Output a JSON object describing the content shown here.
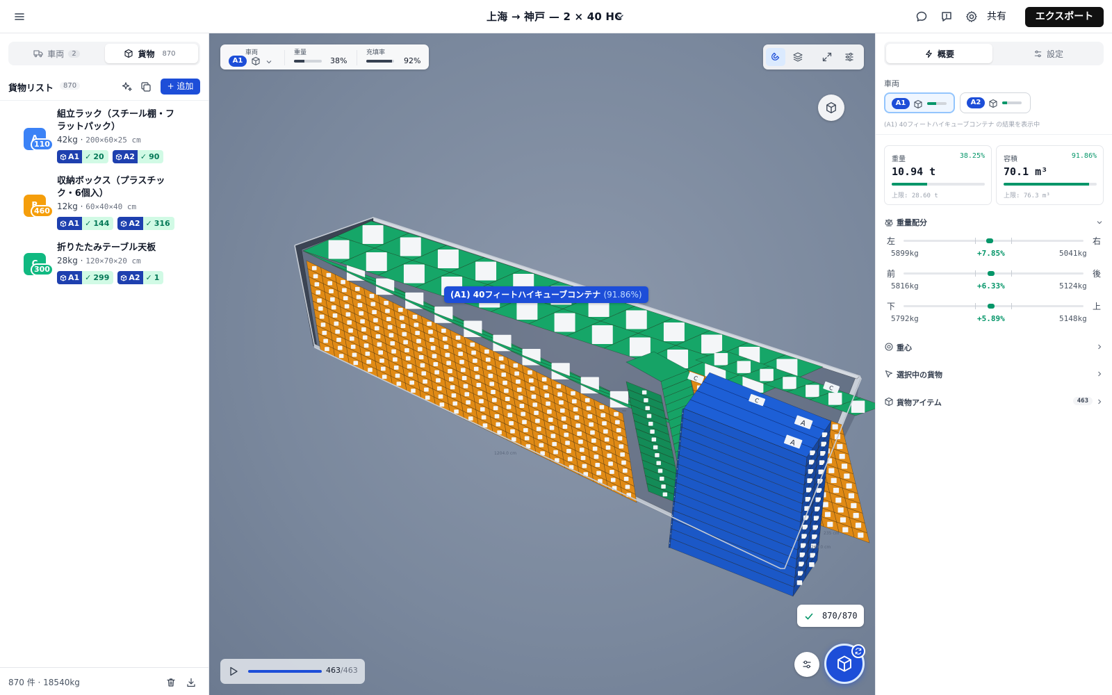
{
  "header": {
    "route_title": "上海 → 神戸 — 2 × 40 HC",
    "share_label": "共有",
    "export_label": "エクスポート"
  },
  "left": {
    "tabs": [
      {
        "label": "車両",
        "count": "2"
      },
      {
        "label": "貨物",
        "count": "870"
      }
    ],
    "list_title": "貨物リスト",
    "list_count": "870",
    "add_label": "+ 追加",
    "items": [
      {
        "badge": "A",
        "qty": "110",
        "color": "#3b82f6",
        "name": "組立ラック（スチール棚・フラットパック）",
        "weight": "42kg",
        "dims": "200×60×25 cm",
        "alloc": [
          {
            "vehicle": "A1",
            "count": "20"
          },
          {
            "vehicle": "A2",
            "count": "90"
          }
        ]
      },
      {
        "badge": "B",
        "qty": "460",
        "color": "#f59e0b",
        "name": "収納ボックス（プラスチック・6個入）",
        "weight": "12kg",
        "dims": "60×40×40 cm",
        "alloc": [
          {
            "vehicle": "A1",
            "count": "144"
          },
          {
            "vehicle": "A2",
            "count": "316"
          }
        ]
      },
      {
        "badge": "C",
        "qty": "300",
        "color": "#10b981",
        "name": "折りたたみテーブル天板",
        "weight": "28kg",
        "dims": "120×70×20 cm",
        "alloc": [
          {
            "vehicle": "A1",
            "count": "299"
          },
          {
            "vehicle": "A2",
            "count": "1"
          }
        ]
      }
    ],
    "footer": "870 件 · 18540kg"
  },
  "viewport": {
    "hud": {
      "vehicle_label": "車両",
      "vehicle_id": "A1",
      "weight_label": "重量",
      "weight_value": "38%",
      "weight_fraction": 0.38,
      "fill_label": "充填率",
      "fill_value": "92%",
      "fill_fraction": 0.92
    },
    "container_label": "(A1) 40フィートハイキューブコンテナ",
    "container_pct": "(91.86%)",
    "dim_labels": [
      "1204.0 cm",
      "235 cm",
      "269.0 cm"
    ],
    "progress_label": "870/870",
    "play_current": "463",
    "play_total": "/463",
    "play_fraction": 1.0,
    "colors": {
      "a": "#1d5fd6",
      "b": "#e08a15",
      "c": "#16a366"
    },
    "box_letters": [
      "A",
      "B",
      "C"
    ]
  },
  "right": {
    "tabs": [
      {
        "label": "概要",
        "icon": "lightning-icon"
      },
      {
        "label": "設定",
        "icon": "sliders-icon"
      }
    ],
    "vehicle_section": "車両",
    "vehicles": [
      {
        "id": "A1",
        "fill": 0.45
      },
      {
        "id": "A2",
        "fill": 0.25
      }
    ],
    "vehicle_note": "(A1) 40フィートハイキューブコンテナ の結果を表示中",
    "weight_card": {
      "label": "重量",
      "pct": "38.25%",
      "value": "10.94 t",
      "fraction": 0.3825,
      "limit": "上限: 28.60 t"
    },
    "volume_card": {
      "label": "容積",
      "pct": "91.86%",
      "value": "70.1 m³",
      "fraction": 0.9186,
      "limit": "上限: 76.3 m³"
    },
    "weight_dist": {
      "title": "重量配分",
      "rows": [
        {
          "left": "左",
          "right": "右",
          "lv": "5899kg",
          "mid": "+7.85%",
          "rv": "5041kg",
          "pos": 0.48
        },
        {
          "left": "前",
          "right": "後",
          "lv": "5816kg",
          "mid": "+6.33%",
          "rv": "5124kg",
          "pos": 0.485
        },
        {
          "left": "下",
          "right": "上",
          "lv": "5792kg",
          "mid": "+5.89%",
          "rv": "5148kg",
          "pos": 0.485
        }
      ]
    },
    "sections": [
      {
        "title": "重心"
      },
      {
        "title": "選択中の貨物"
      },
      {
        "title": "貨物アイテム",
        "badge": "463"
      }
    ]
  }
}
